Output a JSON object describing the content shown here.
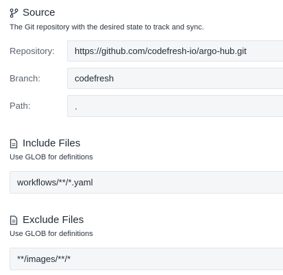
{
  "source": {
    "title": "Source",
    "icon": "git-branch-icon",
    "description": "The Git repository with the desired state to track and sync.",
    "fields": [
      {
        "label": "Repository:",
        "value": "https://github.com/codefresh-io/argo-hub.git"
      },
      {
        "label": "Branch:",
        "value": "codefresh"
      },
      {
        "label": "Path:",
        "value": "."
      }
    ]
  },
  "include": {
    "title": "Include Files",
    "icon": "file-icon",
    "description": "Use GLOB for definitions",
    "value": "workflows/**/*.yaml"
  },
  "exclude": {
    "title": "Exclude Files",
    "icon": "file-icon",
    "description": "Use GLOB for definitions",
    "value": "**/images/**/*"
  }
}
